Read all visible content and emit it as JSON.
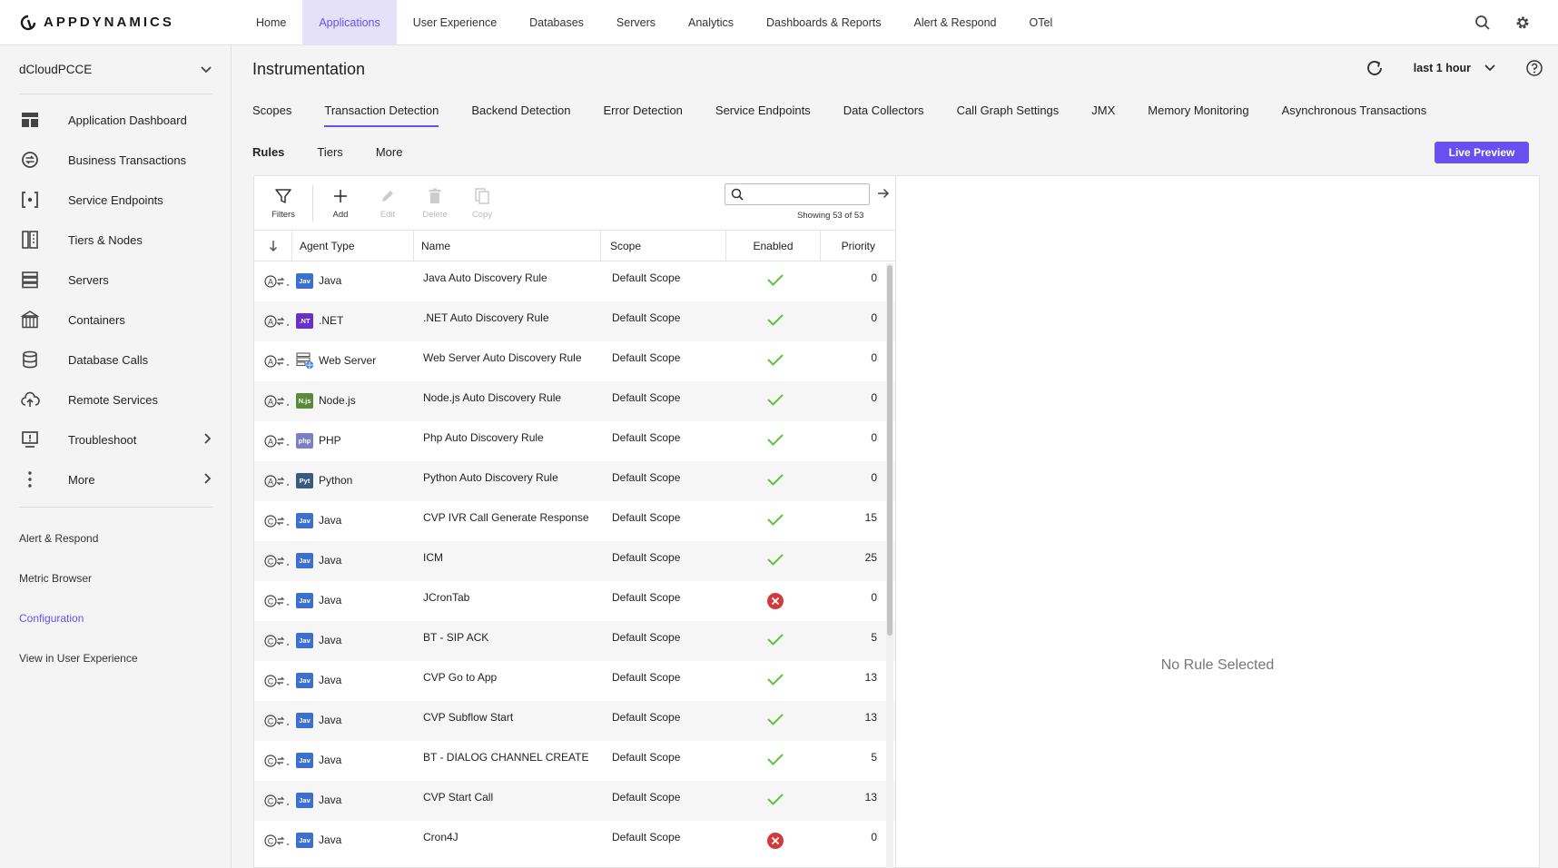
{
  "brand": {
    "name": "APPDYNAMICS"
  },
  "topnav": {
    "items": [
      {
        "label": "Home",
        "active": false
      },
      {
        "label": "Applications",
        "active": true
      },
      {
        "label": "User Experience",
        "active": false
      },
      {
        "label": "Databases",
        "active": false
      },
      {
        "label": "Servers",
        "active": false
      },
      {
        "label": "Analytics",
        "active": false
      },
      {
        "label": "Dashboards & Reports",
        "active": false
      },
      {
        "label": "Alert & Respond",
        "active": false
      },
      {
        "label": "OTel",
        "active": false
      }
    ]
  },
  "sidebar": {
    "app_name": "dCloudPCCE",
    "items": [
      {
        "label": "Application Dashboard",
        "icon": "dashboard-icon"
      },
      {
        "label": "Business Transactions",
        "icon": "business-transactions-icon"
      },
      {
        "label": "Service Endpoints",
        "icon": "service-endpoints-icon"
      },
      {
        "label": "Tiers & Nodes",
        "icon": "tiers-nodes-icon"
      },
      {
        "label": "Servers",
        "icon": "servers-icon"
      },
      {
        "label": "Containers",
        "icon": "containers-icon"
      },
      {
        "label": "Database Calls",
        "icon": "database-icon"
      },
      {
        "label": "Remote Services",
        "icon": "cloud-upload-icon"
      },
      {
        "label": "Troubleshoot",
        "icon": "troubleshoot-icon"
      },
      {
        "label": "More",
        "icon": "more-vertical-icon"
      }
    ],
    "links": [
      {
        "label": "Alert & Respond",
        "active": false
      },
      {
        "label": "Metric Browser",
        "active": false
      },
      {
        "label": "Configuration",
        "active": true
      },
      {
        "label": "View in User Experience",
        "active": false
      }
    ]
  },
  "header": {
    "title": "Instrumentation",
    "time_range": "last 1 hour"
  },
  "tabs": [
    {
      "label": "Scopes",
      "active": false
    },
    {
      "label": "Transaction Detection",
      "active": true
    },
    {
      "label": "Backend Detection",
      "active": false
    },
    {
      "label": "Error Detection",
      "active": false
    },
    {
      "label": "Service Endpoints",
      "active": false
    },
    {
      "label": "Data Collectors",
      "active": false
    },
    {
      "label": "Call Graph Settings",
      "active": false
    },
    {
      "label": "JMX",
      "active": false
    },
    {
      "label": "Memory Monitoring",
      "active": false
    },
    {
      "label": "Asynchronous Transactions",
      "active": false
    }
  ],
  "subtabs": [
    {
      "label": "Rules",
      "active": true
    },
    {
      "label": "Tiers",
      "active": false
    },
    {
      "label": "More",
      "active": false
    }
  ],
  "live_preview_label": "Live Preview",
  "toolbar": {
    "filters": "Filters",
    "add": "Add",
    "edit": "Edit",
    "delete": "Delete",
    "copy": "Copy",
    "search_placeholder": "",
    "showing": "Showing 53 of 53"
  },
  "table": {
    "columns": [
      "Agent Type",
      "Name",
      "Scope",
      "Enabled",
      "Priority"
    ],
    "rows": [
      {
        "rule_kind": "auto",
        "agent": "Java",
        "badge": "Jav",
        "badge_color": "#3b6fd0",
        "name": "Java Auto Discovery Rule",
        "scope": "Default Scope",
        "enabled": true,
        "priority": "0"
      },
      {
        "rule_kind": "auto",
        "agent": ".NET",
        "badge": ".NT",
        "badge_color": "#6b2fc9",
        "name": ".NET Auto Discovery Rule",
        "scope": "Default Scope",
        "enabled": true,
        "priority": "0"
      },
      {
        "rule_kind": "auto",
        "agent": "Web Server",
        "badge": "",
        "badge_color": "",
        "name": "Web Server Auto Discovery Rule",
        "scope": "Default Scope",
        "enabled": true,
        "priority": "0"
      },
      {
        "rule_kind": "auto",
        "agent": "Node.js",
        "badge": "N.js",
        "badge_color": "#5a8a3c",
        "name": "Node.js Auto Discovery Rule",
        "scope": "Default Scope",
        "enabled": true,
        "priority": "0"
      },
      {
        "rule_kind": "auto",
        "agent": "PHP",
        "badge": "php",
        "badge_color": "#7b7fc4",
        "name": "Php Auto Discovery Rule",
        "scope": "Default Scope",
        "enabled": true,
        "priority": "0"
      },
      {
        "rule_kind": "auto",
        "agent": "Python",
        "badge": "Pyt",
        "badge_color": "#3a5a80",
        "name": "Python Auto Discovery Rule",
        "scope": "Default Scope",
        "enabled": true,
        "priority": "0"
      },
      {
        "rule_kind": "custom",
        "agent": "Java",
        "badge": "Jav",
        "badge_color": "#3b6fd0",
        "name": "CVP IVR Call Generate Response",
        "scope": "Default Scope",
        "enabled": true,
        "priority": "15"
      },
      {
        "rule_kind": "custom",
        "agent": "Java",
        "badge": "Jav",
        "badge_color": "#3b6fd0",
        "name": "ICM",
        "scope": "Default Scope",
        "enabled": true,
        "priority": "25"
      },
      {
        "rule_kind": "custom",
        "agent": "Java",
        "badge": "Jav",
        "badge_color": "#3b6fd0",
        "name": "JCronTab",
        "scope": "Default Scope",
        "enabled": false,
        "priority": "0"
      },
      {
        "rule_kind": "custom",
        "agent": "Java",
        "badge": "Jav",
        "badge_color": "#3b6fd0",
        "name": "BT - SIP ACK",
        "scope": "Default Scope",
        "enabled": true,
        "priority": "5"
      },
      {
        "rule_kind": "custom",
        "agent": "Java",
        "badge": "Jav",
        "badge_color": "#3b6fd0",
        "name": "CVP Go to App",
        "scope": "Default Scope",
        "enabled": true,
        "priority": "13"
      },
      {
        "rule_kind": "custom",
        "agent": "Java",
        "badge": "Jav",
        "badge_color": "#3b6fd0",
        "name": "CVP Subflow Start",
        "scope": "Default Scope",
        "enabled": true,
        "priority": "13"
      },
      {
        "rule_kind": "custom",
        "agent": "Java",
        "badge": "Jav",
        "badge_color": "#3b6fd0",
        "name": "BT - DIALOG CHANNEL CREATE",
        "scope": "Default Scope",
        "enabled": true,
        "priority": "5"
      },
      {
        "rule_kind": "custom",
        "agent": "Java",
        "badge": "Jav",
        "badge_color": "#3b6fd0",
        "name": "CVP Start Call",
        "scope": "Default Scope",
        "enabled": true,
        "priority": "13"
      },
      {
        "rule_kind": "custom",
        "agent": "Java",
        "badge": "Jav",
        "badge_color": "#3b6fd0",
        "name": "Cron4J",
        "scope": "Default Scope",
        "enabled": false,
        "priority": "0"
      }
    ]
  },
  "detail": {
    "empty_message": "No Rule Selected"
  },
  "colors": {
    "accent": "#6a4ff0",
    "enabled": "#5cc43f",
    "disabled": "#d23b3b"
  }
}
